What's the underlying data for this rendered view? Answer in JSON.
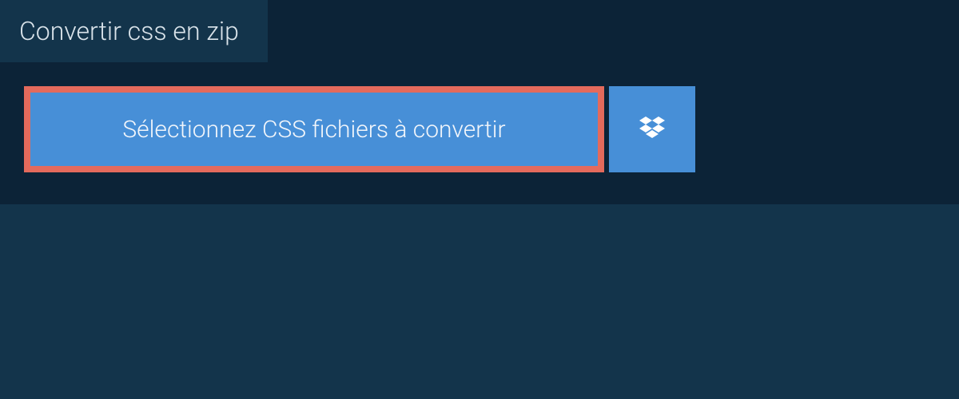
{
  "tab": {
    "label": "Convertir css en zip"
  },
  "actions": {
    "select_label": "Sélectionnez CSS fichiers à convertir"
  }
}
